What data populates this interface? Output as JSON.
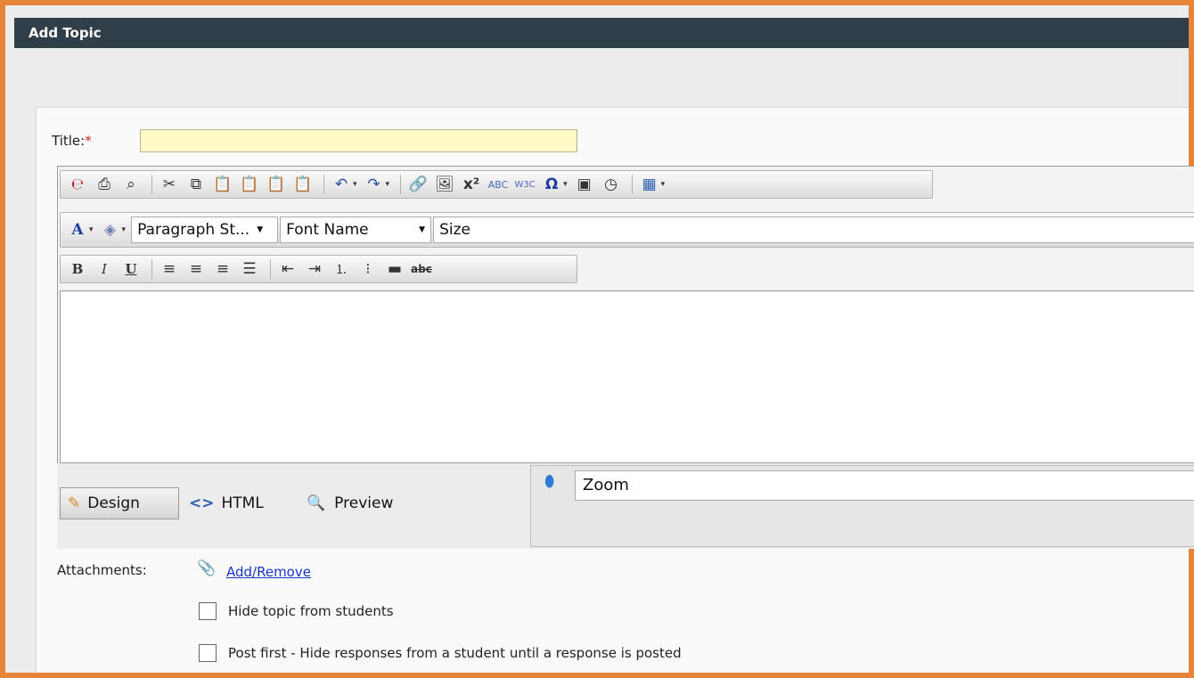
{
  "window": {
    "title": "Add Topic"
  },
  "form": {
    "title_label": "Title:",
    "required_mark": "*",
    "title_value": ""
  },
  "toolbar1": {
    "icons": [
      "html-edit-icon",
      "print-icon",
      "find-icon",
      "cut-icon",
      "copy-icon",
      "paste-icon",
      "paste-text-icon",
      "paste-word-icon",
      "paste-html-icon",
      "undo-icon",
      "redo-icon",
      "hyperlink-icon",
      "image-icon",
      "superscript-icon",
      "spellcheck-icon",
      "w3c-icon",
      "special-char-icon",
      "form-icon",
      "clock-icon",
      "table-icon"
    ]
  },
  "toolbar2": {
    "paragraph_style": "Paragraph St...",
    "font_name": "Font Name",
    "size": "Size"
  },
  "toolbar3": {
    "icons": [
      "bold-icon",
      "italic-icon",
      "underline-icon",
      "align-left-icon",
      "align-center-icon",
      "align-right-icon",
      "justify-icon",
      "outdent-icon",
      "indent-icon",
      "numbered-list-icon",
      "bullet-list-icon",
      "horizontal-rule-icon",
      "strikethrough-icon"
    ]
  },
  "modes": {
    "design": "Design",
    "html": "HTML",
    "preview": "Preview"
  },
  "zoom": {
    "label": "Zoom"
  },
  "attachments": {
    "label": "Attachments:",
    "link": "Add/Remove"
  },
  "options": {
    "hide_topic": "Hide topic from students",
    "post_first": "Post first - Hide responses from a student until a response is posted"
  }
}
